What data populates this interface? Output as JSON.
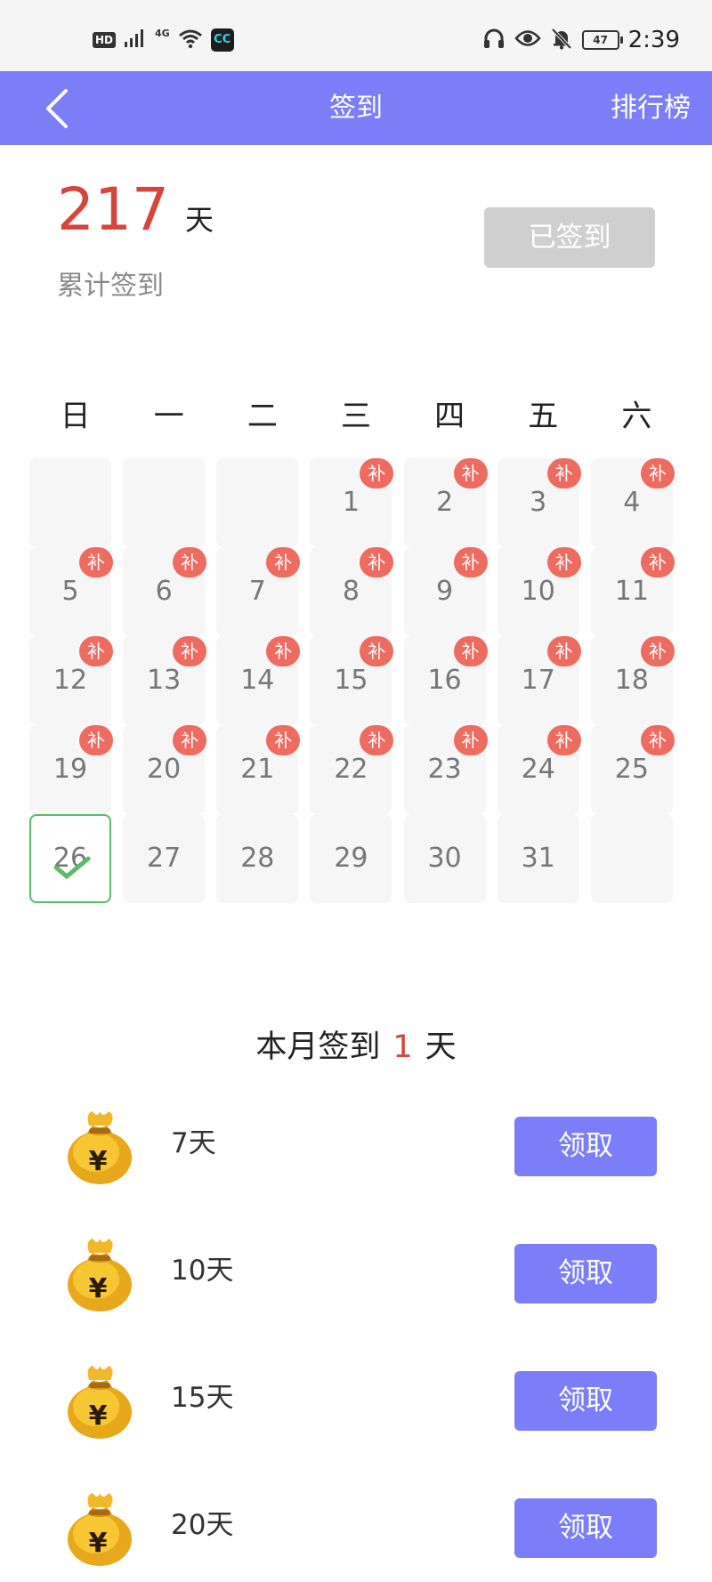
{
  "status_bar": {
    "hd": "HD",
    "network": "4G",
    "app_icon": "CC",
    "battery": "47",
    "time": "2:39",
    "icons": [
      "headphones-icon",
      "eye-icon",
      "bell-off-icon"
    ]
  },
  "nav": {
    "title": "签到",
    "rank": "排行榜",
    "back_icon": "chevron-left-icon"
  },
  "summary": {
    "total_days": "217",
    "unit": "天",
    "label": "累计签到",
    "signed_button": "已签到"
  },
  "weekdays": [
    "日",
    "一",
    "二",
    "三",
    "四",
    "五",
    "六"
  ],
  "calendar": {
    "first_weekday": 3,
    "days_in_month": 31,
    "today": 26,
    "makeup_label": "补",
    "makeup_days": [
      1,
      2,
      3,
      4,
      5,
      6,
      7,
      8,
      9,
      10,
      11,
      12,
      13,
      14,
      15,
      16,
      17,
      18,
      19,
      20,
      21,
      22,
      23,
      24,
      25
    ]
  },
  "month_summary": {
    "prefix": "本月签到",
    "count": "1",
    "unit": "天"
  },
  "rewards": [
    {
      "days": "7天",
      "button": "领取"
    },
    {
      "days": "10天",
      "button": "领取"
    },
    {
      "days": "15天",
      "button": "领取"
    },
    {
      "days": "20天",
      "button": "领取"
    }
  ],
  "colors": {
    "accent": "#7b7ef8",
    "highlight": "#d8443a",
    "badge": "#ee6b60",
    "check": "#5cba6a",
    "disabled": "#cfcfcf"
  }
}
